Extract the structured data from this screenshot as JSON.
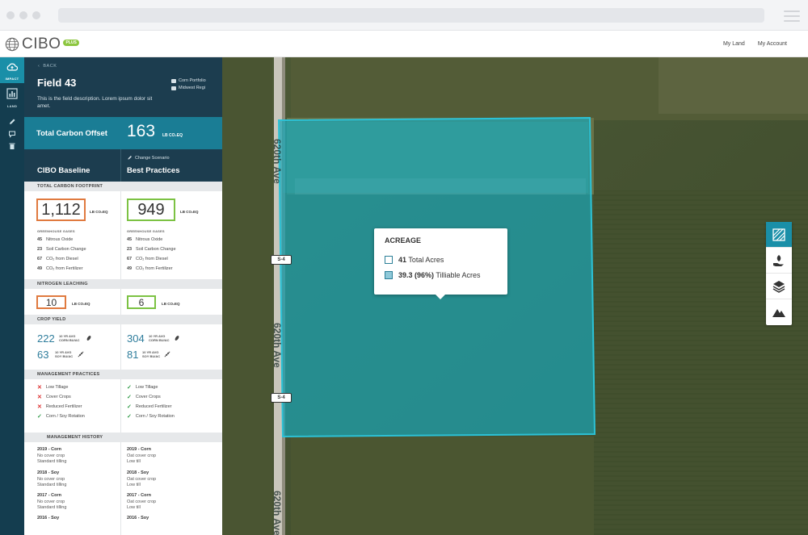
{
  "header": {
    "logo_text": "CIBO",
    "logo_badge": "PLUS",
    "links": [
      "My Land",
      "My Account"
    ]
  },
  "rail": {
    "items": [
      {
        "label": "IMPACT",
        "icon": "cloud-icon"
      },
      {
        "label": "LAND",
        "icon": "chart-icon"
      }
    ]
  },
  "panel": {
    "back": "BACK",
    "title": "Field 43",
    "description": "This is the field description. Lorem ipsum dolor sit amet.",
    "tags": [
      "Corn Portfolio",
      "Midwest Regi"
    ],
    "offset_label": "Total Carbon Offset",
    "offset_value": "163",
    "offset_unit": "LB CO₂EQ",
    "change_scenario": "Change Scenario",
    "col_left": "CIBO Baseline",
    "col_right": "Best Practices",
    "sections": {
      "footprint": "TOTAL CARBON FOOTPRINT",
      "nitrogen": "NITROGEN LEACHING",
      "yield": "CROP YIELD",
      "practices": "MANAGEMENT PRACTICES",
      "history": "MANAGEMENT HISTORY"
    },
    "footprint": {
      "baseline_value": "1,112",
      "best_value": "949",
      "unit": "LB CO₂EQ",
      "gases_label": "GREENHOUSE GASES",
      "baseline_gases": [
        {
          "v": "45",
          "l": "Nitrous Oxide"
        },
        {
          "v": "23",
          "l": "Soil Carbon Change"
        },
        {
          "v": "67",
          "l": "CO₂ from Diesel"
        },
        {
          "v": "49",
          "l": "CO₂ from Fertilizer"
        }
      ],
      "best_gases": [
        {
          "v": "45",
          "l": "Nitrous Oxide"
        },
        {
          "v": "23",
          "l": "Soil Carbon Change"
        },
        {
          "v": "67",
          "l": "CO₂ from Diesel"
        },
        {
          "v": "49",
          "l": "CO₂ from Fertilizer"
        }
      ]
    },
    "nitrogen": {
      "baseline_value": "10",
      "best_value": "6",
      "unit": "LB CO₂EQ"
    },
    "yield": {
      "baseline": [
        {
          "v": "222",
          "l1": "10 YR AVG",
          "l2": "CORN BU/AC"
        },
        {
          "v": "63",
          "l1": "10 YR AVG",
          "l2": "SOY BU/AC"
        }
      ],
      "best": [
        {
          "v": "304",
          "l1": "10 YR AVG",
          "l2": "CORN BU/AC"
        },
        {
          "v": "81",
          "l1": "10 YR AVG",
          "l2": "SOY BU/AC"
        }
      ]
    },
    "practices": {
      "baseline": [
        "Low Tillage",
        "Cover Crops",
        "Reduced Fertilizer",
        "Corn / Soy Rotation"
      ],
      "baseline_status": [
        "x",
        "x",
        "x",
        "check"
      ],
      "best": [
        "Low Tillage",
        "Cover Crops",
        "Reduced Fertilizer",
        "Corn / Soy Rotation"
      ]
    },
    "history": {
      "baseline": [
        {
          "year": "2019 - Corn",
          "lines": [
            "No cover crop",
            "Standard tilling"
          ]
        },
        {
          "year": "2018 - Soy",
          "lines": [
            "No cover crop",
            "Standard tilling"
          ]
        },
        {
          "year": "2017 - Corn",
          "lines": [
            "No cover crop",
            "Standard tilling"
          ]
        },
        {
          "year": "2016 - Soy",
          "lines": []
        }
      ],
      "best": [
        {
          "year": "2019 - Corn",
          "lines": [
            "Oat cover crop",
            "Low till"
          ]
        },
        {
          "year": "2018 - Soy",
          "lines": [
            "Oat cover crop",
            "Low till"
          ]
        },
        {
          "year": "2017 - Corn",
          "lines": [
            "Oat cover crop",
            "Low till"
          ]
        },
        {
          "year": "2016 - Soy",
          "lines": []
        }
      ]
    }
  },
  "map": {
    "road_name": "620th Ave",
    "road_signs": [
      "S-4",
      "S-4"
    ],
    "tooltip": {
      "title": "ACREAGE",
      "total_value": "41",
      "total_label": "Total Acres",
      "tillable_value": "39.3 (96%)",
      "tillable_label": "Tilliable Acres"
    },
    "tools": [
      "hatch-icon",
      "hand-leaf-icon",
      "layers-icon",
      "mountain-icon"
    ]
  },
  "colors": {
    "rail": "#143d4f",
    "panel_head": "#1c3d4f",
    "accent": "#1a7d95",
    "field_fill": "#1aa3b3",
    "baseline_box": "#e07a3f",
    "best_box": "#7cc243"
  }
}
